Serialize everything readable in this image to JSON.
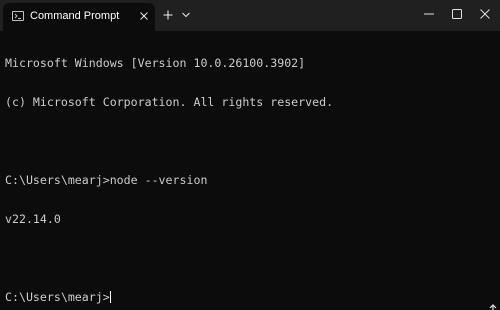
{
  "window": {
    "tab_title": "Command Prompt",
    "icons": {
      "tab": "terminal-icon",
      "close_tab": "close-icon",
      "new_tab": "plus-icon",
      "dropdown": "chevron-down-icon",
      "minimize": "minimize-icon",
      "maximize": "maximize-icon",
      "close": "close-icon"
    }
  },
  "terminal": {
    "lines": [
      "Microsoft Windows [Version 10.0.26100.3902]",
      "(c) Microsoft Corporation. All rights reserved.",
      "",
      "C:\\Users\\mearj>node --version",
      "v22.14.0",
      "",
      "C:\\Users\\mearj>"
    ]
  },
  "colors": {
    "background": "#0c0c0c",
    "titlebar": "#202020",
    "text": "#cccccc"
  }
}
